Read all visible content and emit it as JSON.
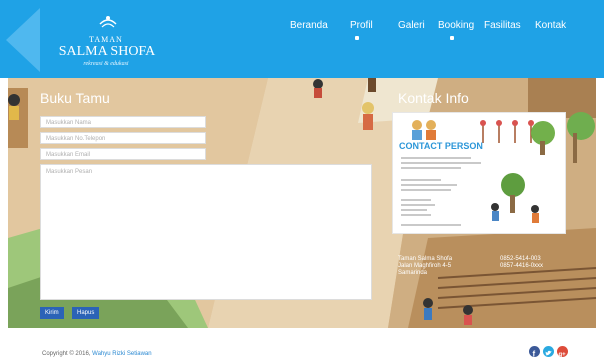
{
  "header": {
    "logo_small": "TAMAN",
    "logo_big": "SALMA SHOFA",
    "logo_tag": "rekreasi & edukasi",
    "nav": [
      "Beranda",
      "Profil",
      "Galeri",
      "Booking",
      "Fasilitas",
      "Kontak"
    ]
  },
  "guestbook": {
    "title": "Buku Tamu",
    "name_placeholder": "Masukkan Nama",
    "phone_placeholder": "Masukkan No.Telepon",
    "email_placeholder": "Masukkan Email",
    "message_placeholder": "Masukkan Pesan",
    "submit_label": "Kirim",
    "reset_label": "Hapus"
  },
  "contact": {
    "title": "Kontak Info",
    "card_heading": "CONTACT PERSON",
    "address_lines": [
      "Taman Salma Shofa",
      "Jalan Maghfiroh 4-5",
      "Samarinda"
    ],
    "phone_lines": [
      "0852-5414-003",
      "0857-4416-0xxx"
    ]
  },
  "footer": {
    "copyright": "Copyright © 2016,",
    "author": "Wahyu Rizki Setiawan"
  },
  "colors": {
    "header_bg": "#1fa2e6",
    "button": "#2b63b7",
    "facebook": "#3b5998",
    "twitter": "#2aa9e0",
    "google_plus": "#dd4b39"
  }
}
